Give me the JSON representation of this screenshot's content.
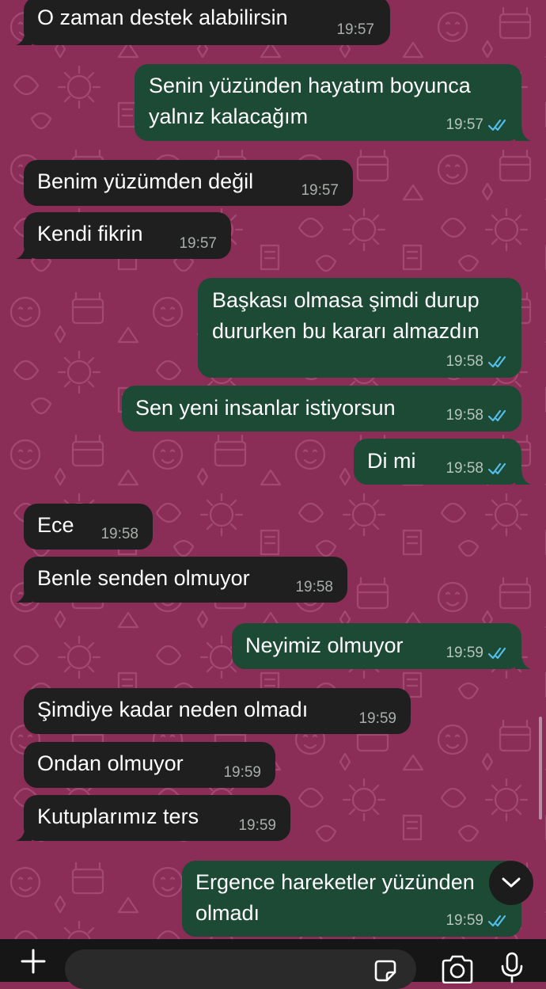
{
  "theme": {
    "wallpaper": "#8a2e58",
    "incoming_bubble": "#1f1f1f",
    "outgoing_bubble": "#1c4a34",
    "read_tick": "#53bdeb"
  },
  "messages": [
    {
      "dir": "in",
      "text": "O zaman destek alabilirsin",
      "time": "19:57"
    },
    {
      "dir": "out",
      "lines": [
        "Senin yüzünden hayatım boyunca",
        "yalnız kalacağım"
      ],
      "time": "19:57",
      "status": "read"
    },
    {
      "dir": "in",
      "text": "Benim yüzümden değil",
      "time": "19:57"
    },
    {
      "dir": "in",
      "text": "Kendi fikrin",
      "time": "19:57"
    },
    {
      "dir": "out",
      "lines": [
        "Başkası olmasa şimdi durup",
        "dururken bu kararı almazdın"
      ],
      "time": "19:58",
      "status": "read"
    },
    {
      "dir": "out",
      "text": "Sen yeni insanlar istiyorsun",
      "time": "19:58",
      "status": "read"
    },
    {
      "dir": "out",
      "text": "Di mi",
      "time": "19:58",
      "status": "read"
    },
    {
      "dir": "in",
      "text": "Ece",
      "time": "19:58"
    },
    {
      "dir": "in",
      "text": "Benle senden olmuyor",
      "time": "19:58"
    },
    {
      "dir": "out",
      "text": "Neyimiz olmuyor",
      "time": "19:59",
      "status": "read"
    },
    {
      "dir": "in",
      "text": "Şimdiye kadar neden olmadı",
      "time": "19:59"
    },
    {
      "dir": "in",
      "text": "Ondan olmuyor",
      "time": "19:59"
    },
    {
      "dir": "in",
      "text": "Kutuplarımız ters",
      "time": "19:59"
    },
    {
      "dir": "out",
      "lines": [
        "Ergence hareketler yüzünden",
        "olmadı"
      ],
      "time": "19:59",
      "status": "read"
    }
  ],
  "composer": {
    "input_value": "",
    "icons": [
      "plus-icon",
      "sticker-icon",
      "camera-icon",
      "microphone-icon"
    ]
  },
  "scroll_down_icon": "chevron-down-icon"
}
